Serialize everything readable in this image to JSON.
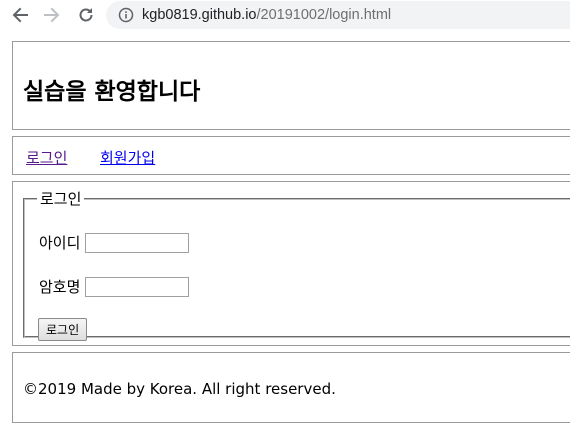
{
  "browser": {
    "url_host": "kgb0819.github.io",
    "url_path": "/20191002/login.html"
  },
  "header": {
    "title": "실습을 환영합니다"
  },
  "nav": {
    "items": [
      {
        "label": "로그인"
      },
      {
        "label": "회원가입"
      }
    ]
  },
  "login_form": {
    "legend": "로그인",
    "id_label": "아이디",
    "id_value": "",
    "password_label": "암호명",
    "password_value": "",
    "submit_label": "로그인"
  },
  "footer": {
    "text": "©2019 Made by Korea. All right reserved."
  }
}
